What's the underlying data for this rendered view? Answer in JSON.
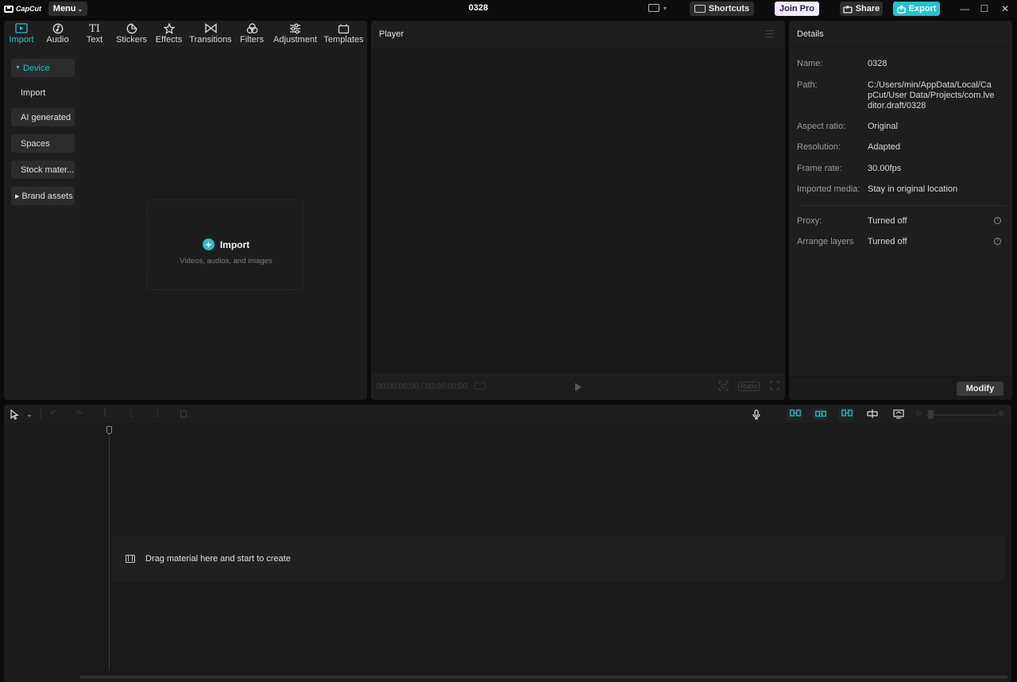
{
  "titlebar": {
    "app_name": "CapCut",
    "menu_label": "Menu",
    "project_title": "0328",
    "shortcuts_label": "Shortcuts",
    "joinpro_label": "Join Pro",
    "share_label": "Share",
    "export_label": "Export",
    "accent_color": "#1ec4ce"
  },
  "media": {
    "tabs": [
      {
        "label": "Import",
        "icon": "import-icon",
        "active": true
      },
      {
        "label": "Audio",
        "icon": "audio-icon"
      },
      {
        "label": "Text",
        "icon": "text-icon"
      },
      {
        "label": "Stickers",
        "icon": "stickers-icon"
      },
      {
        "label": "Effects",
        "icon": "effects-icon"
      },
      {
        "label": "Transitions",
        "icon": "transitions-icon"
      },
      {
        "label": "Filters",
        "icon": "filters-icon"
      },
      {
        "label": "Adjustment",
        "icon": "adjustment-icon"
      },
      {
        "label": "Templates",
        "icon": "templates-icon"
      }
    ],
    "sidebar": [
      {
        "label": "Device",
        "selected": true,
        "expanded": true
      },
      {
        "label": "Import"
      },
      {
        "label": "AI generated"
      },
      {
        "label": "Spaces"
      },
      {
        "label": "Stock mater..."
      },
      {
        "label": "Brand assets",
        "collapsed": true
      }
    ],
    "import_box": {
      "title": "Import",
      "subtitle": "Videos, audios, and images"
    }
  },
  "player": {
    "title": "Player",
    "current_time": "00:00:00:00",
    "total_time": "00:00:00:00",
    "ratio_label": "Ratio"
  },
  "details": {
    "title": "Details",
    "rows": [
      {
        "label": "Name:",
        "value": "0328"
      },
      {
        "label": "Path:",
        "value": "C:/Users/min/AppData/Local/CapCut/User Data/Projects/com.lveditor.draft/0328"
      },
      {
        "label": "Aspect ratio:",
        "value": "Original"
      },
      {
        "label": "Resolution:",
        "value": "Adapted"
      },
      {
        "label": "Frame rate:",
        "value": "30.00fps"
      },
      {
        "label": "Imported media:",
        "value": "Stay in original location"
      },
      {
        "label": "Proxy:",
        "value": "Turned off"
      },
      {
        "label": "Arrange layers",
        "value": "Turned off"
      }
    ],
    "modify_label": "Modify"
  },
  "timeline": {
    "drop_hint": "Drag material here and start to create"
  }
}
